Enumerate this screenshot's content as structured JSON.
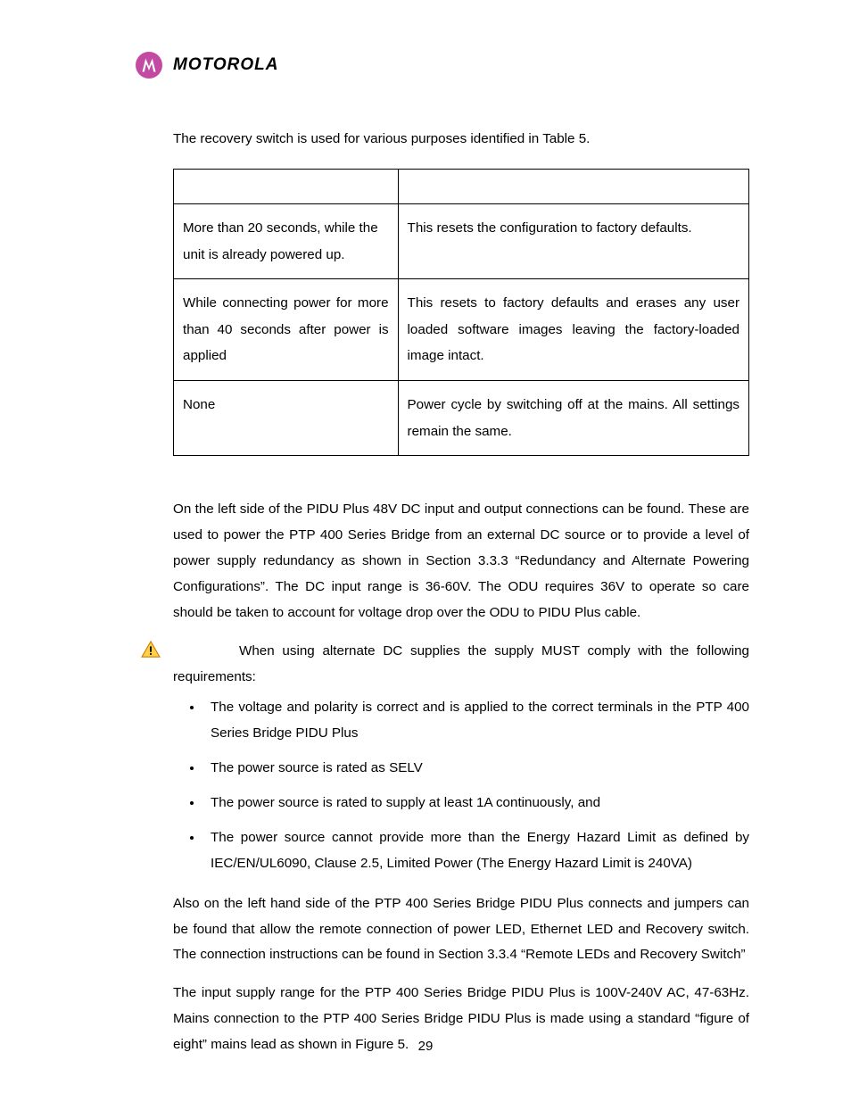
{
  "header": {
    "brand": "MOTOROLA"
  },
  "intro": "The recovery switch is used for various purposes identified in Table 5.",
  "table": {
    "rows": [
      {
        "left": "More than 20 seconds, while the unit is already powered up.",
        "right": "This resets the configuration to factory defaults."
      },
      {
        "left": "While connecting power for more than 40 seconds after power is applied",
        "right": "This resets to factory defaults and erases any user loaded software images leaving the factory-loaded image intact."
      },
      {
        "left": "None",
        "right": "Power cycle by switching off at the mains. All settings remain the same."
      }
    ]
  },
  "para1": "On the left side of the PIDU Plus 48V DC input and output connections can be found. These are used to power the PTP 400 Series Bridge from an external DC source or to provide a level of power supply redundancy as shown in Section 3.3.3 “Redundancy and Alternate Powering Configurations”. The DC input range is 36-60V. The ODU requires 36V to operate so care should be taken to account for voltage drop over the ODU to PIDU Plus cable.",
  "warning": {
    "lead_rest": "When using alternate DC supplies the supply MUST comply with the following requirements:"
  },
  "requirements": [
    "The voltage and polarity is correct and is applied to the correct terminals in the PTP 400 Series Bridge PIDU Plus",
    "The power source is rated as SELV",
    "The power source is rated to supply at least 1A continuously, and",
    "The power source cannot provide more than the Energy Hazard Limit as defined by IEC/EN/UL6090, Clause 2.5, Limited Power (The Energy Hazard Limit is 240VA)"
  ],
  "para2": "Also on the left hand side of the PTP 400 Series Bridge PIDU Plus connects and jumpers can be found that allow the remote connection of power LED, Ethernet LED and Recovery switch. The connection instructions can be found in Section 3.3.4 “Remote LEDs and Recovery Switch”",
  "para3": "The input supply range for the PTP 400 Series Bridge PIDU Plus is 100V-240V AC, 47-63Hz. Mains connection to the PTP 400 Series Bridge PIDU Plus is made using a standard “figure of eight” mains lead as shown in Figure 5.",
  "page_number": "29"
}
